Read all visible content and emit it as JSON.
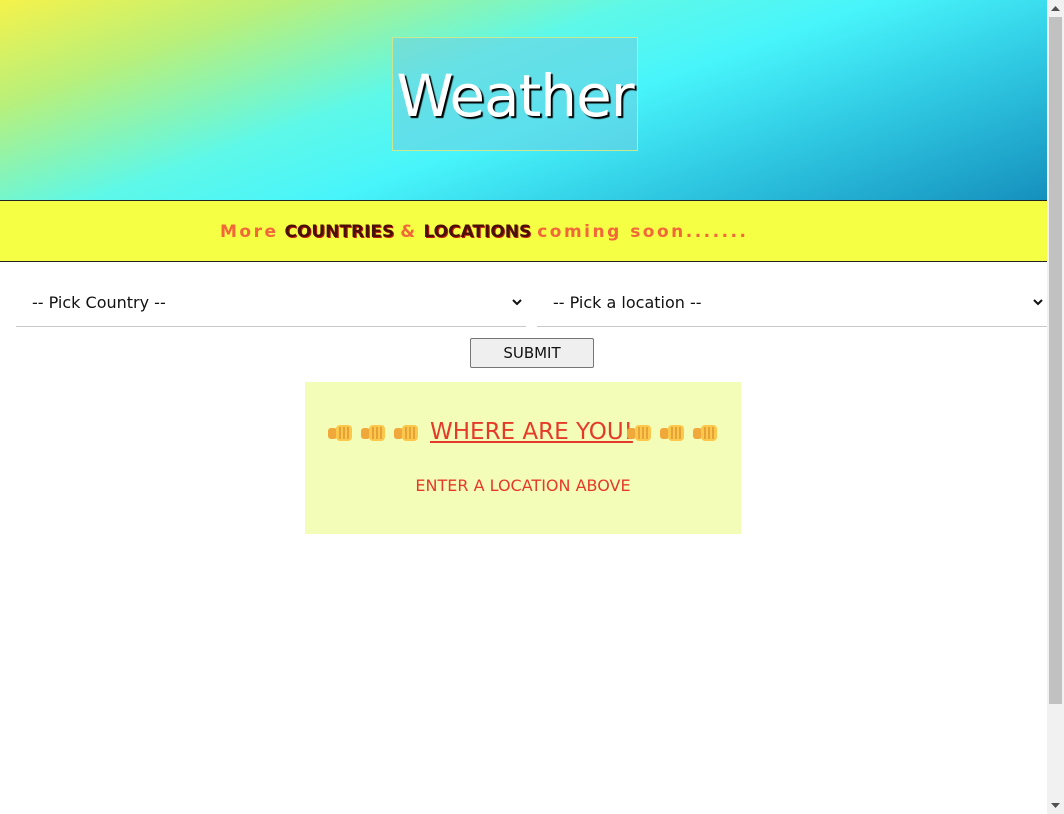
{
  "header": {
    "title": "Weather"
  },
  "banner": {
    "part1": "More",
    "part2": "COUNTRIES",
    "part3": "&",
    "part4": "LOCATIONS",
    "part5": "coming soon......."
  },
  "form": {
    "country_select": {
      "selected": "-- Pick Country --"
    },
    "location_select": {
      "selected": "-- Pick a location --"
    },
    "submit_label": "SUBMIT"
  },
  "panel": {
    "heading": "WHERE ARE YOU!",
    "message": "ENTER A LOCATION ABOVE",
    "icon": "pointing-fist-emoji"
  },
  "colors": {
    "banner_bg": "#f5ff43",
    "banner_text": "#f2663a",
    "panel_bg": "#f4fdb8",
    "panel_text": "#e53a2a"
  }
}
